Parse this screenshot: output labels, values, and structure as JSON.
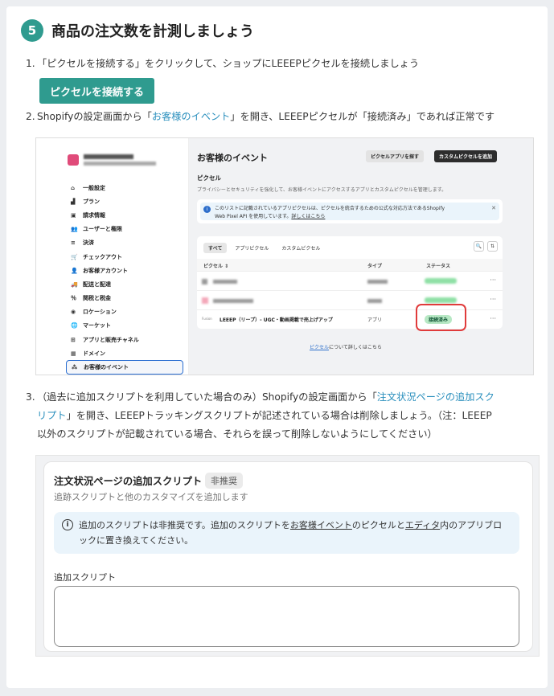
{
  "section": {
    "number": "5",
    "title": "商品の注文数を計測しましょう"
  },
  "steps": {
    "s1": {
      "num": "1.",
      "text": "「ピクセルを接続する」をクリックして、ショップにLEEEPピクセルを接続しましょう",
      "button": "ピクセルを接続する"
    },
    "s2": {
      "num": "2.",
      "pre": "Shopifyの設定画面から「",
      "link": "お客様のイベント",
      "post": "」を開き、LEEEPピクセルが「接続済み」であれば正常です"
    },
    "s3": {
      "num": "3.",
      "l1_pre": "（過去に追加スクリプトを利用していた場合のみ）Shopifyの設定画面から「",
      "l1_link": "注文状況ページの追加スク",
      "l2_link": "リプト",
      "l2_post": "」を開き、LEEEPトラッキングスクリプトが記述されている場合は削除しましょう。（注：LEEEP",
      "l3": "以外のスクリプトが記載されている場合、それらを誤って削除しないようにしてください）"
    }
  },
  "shot1": {
    "nav": [
      {
        "icon": "⌂",
        "label": "一般設定"
      },
      {
        "icon": "▟",
        "label": "プラン"
      },
      {
        "icon": "▣",
        "label": "請求情報"
      },
      {
        "icon": "👥",
        "label": "ユーザーと権限"
      },
      {
        "icon": "≡",
        "label": "決済"
      },
      {
        "icon": "🛒",
        "label": "チェックアウト"
      },
      {
        "icon": "👤",
        "label": "お客様アカウント"
      },
      {
        "icon": "🚚",
        "label": "配送と配達"
      },
      {
        "icon": "％",
        "label": "関税と税金"
      },
      {
        "icon": "◉",
        "label": "ロケーション"
      },
      {
        "icon": "🌐",
        "label": "マーケット"
      },
      {
        "icon": "⊞",
        "label": "アプリと販売チャネル"
      },
      {
        "icon": "▦",
        "label": "ドメイン"
      },
      {
        "icon": "⁂",
        "label": "お客様のイベント"
      }
    ],
    "heading": "お客様のイベント",
    "btn_app": "ピクセルアプリを探す",
    "btn_custom": "カスタムピクセルを追加",
    "pixel_title": "ピクセル",
    "pixel_desc": "プライバシーとセキュリティを強化して、お客様イベントにアクセスするアプリとカスタムピクセルを管理します。",
    "info_l1": "このリストに記載されているアプリピクセルは、ピクセルを統合するための公式な対応方法であるShopify",
    "info_l2": "Web Pixel API を使用しています。",
    "info_link": "詳しくはこちら",
    "tabs": [
      "すべて",
      "アプリピクセル",
      "カスタムピクセル"
    ],
    "col_pixel": "ピクセル ⇕",
    "col_type": "タイプ",
    "col_status": "ステータス",
    "leeep_prefix": "Fusion",
    "leeep_name": "LEEEP（リープ）- UGC・動画掲載で売上げアップ",
    "leeep_type": "アプリ",
    "leeep_status": "接続済み",
    "foot_link": "ピクセル",
    "foot_text": "について詳しくはこちら"
  },
  "shot2": {
    "title": "注文状況ページの追加スクリプト",
    "tag": "非推奨",
    "subtitle": "追跡スクリプトと他のカスタマイズを追加します",
    "info_a": "追加のスクリプトは非推奨です。追加のスクリプトを",
    "info_link1": "お客様イベント",
    "info_b": "のピクセルと",
    "info_link2": "エディタ",
    "info_c": "内のアプリブロ",
    "info_d": "ックに置き換えてください。",
    "label": "追加スクリプト",
    "value": ""
  }
}
